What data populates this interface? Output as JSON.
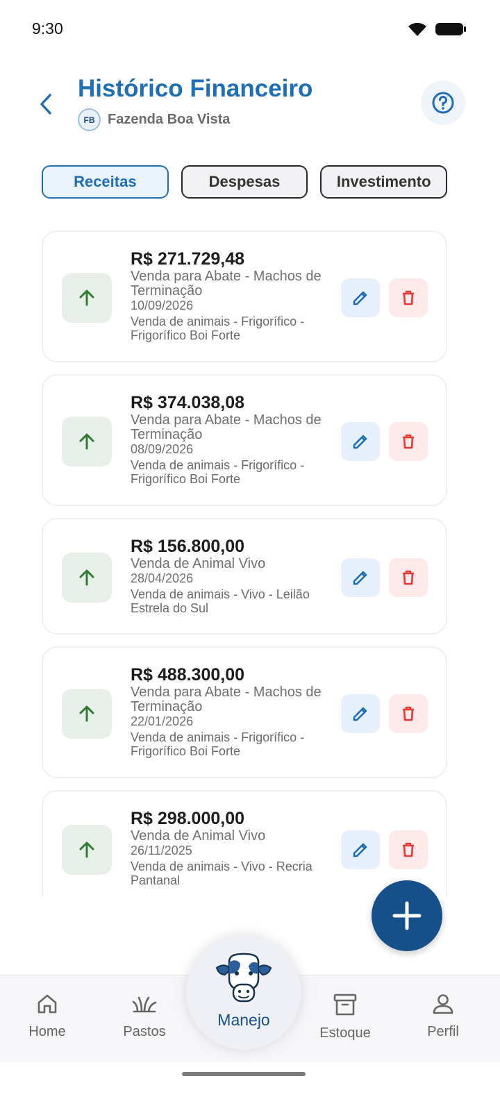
{
  "status_bar": {
    "time": "9:30"
  },
  "header": {
    "title": "Histórico Financeiro",
    "farm_initials": "FB",
    "farm_name": "Fazenda Boa Vista"
  },
  "tabs": [
    {
      "label": "Receitas",
      "active": true
    },
    {
      "label": "Despesas",
      "active": false
    },
    {
      "label": "Investimento",
      "active": false
    }
  ],
  "transactions": [
    {
      "amount": "R$ 271.729,48",
      "description": "Venda para Abate - Machos de Terminação",
      "date": "10/09/2026",
      "note": "Venda de animais - Frigorífico - Frigorífico Boi Forte"
    },
    {
      "amount": "R$ 374.038,08",
      "description": "Venda para Abate - Machos de Terminação",
      "date": "08/09/2026",
      "note": "Venda de animais - Frigorífico - Frigorífico Boi Forte"
    },
    {
      "amount": "R$ 156.800,00",
      "description": "Venda de Animal Vivo",
      "date": "28/04/2026",
      "note": "Venda de animais - Vivo - Leilão Estrela do Sul"
    },
    {
      "amount": "R$ 488.300,00",
      "description": "Venda para Abate - Machos de Terminação",
      "date": "22/01/2026",
      "note": "Venda de animais - Frigorífico - Frigorífico Boi Forte"
    },
    {
      "amount": "R$ 298.000,00",
      "description": "Venda de Animal Vivo",
      "date": "26/11/2025",
      "note": "Venda de animais - Vivo - Recria Pantanal"
    }
  ],
  "bottom_nav": {
    "home": "Home",
    "pastos": "Pastos",
    "manejo": "Manejo",
    "estoque": "Estoque",
    "perfil": "Perfil"
  },
  "colors": {
    "primary": "#1f6fb7",
    "fab": "#16508a",
    "income": "#2e7d32",
    "delete": "#e53935"
  }
}
